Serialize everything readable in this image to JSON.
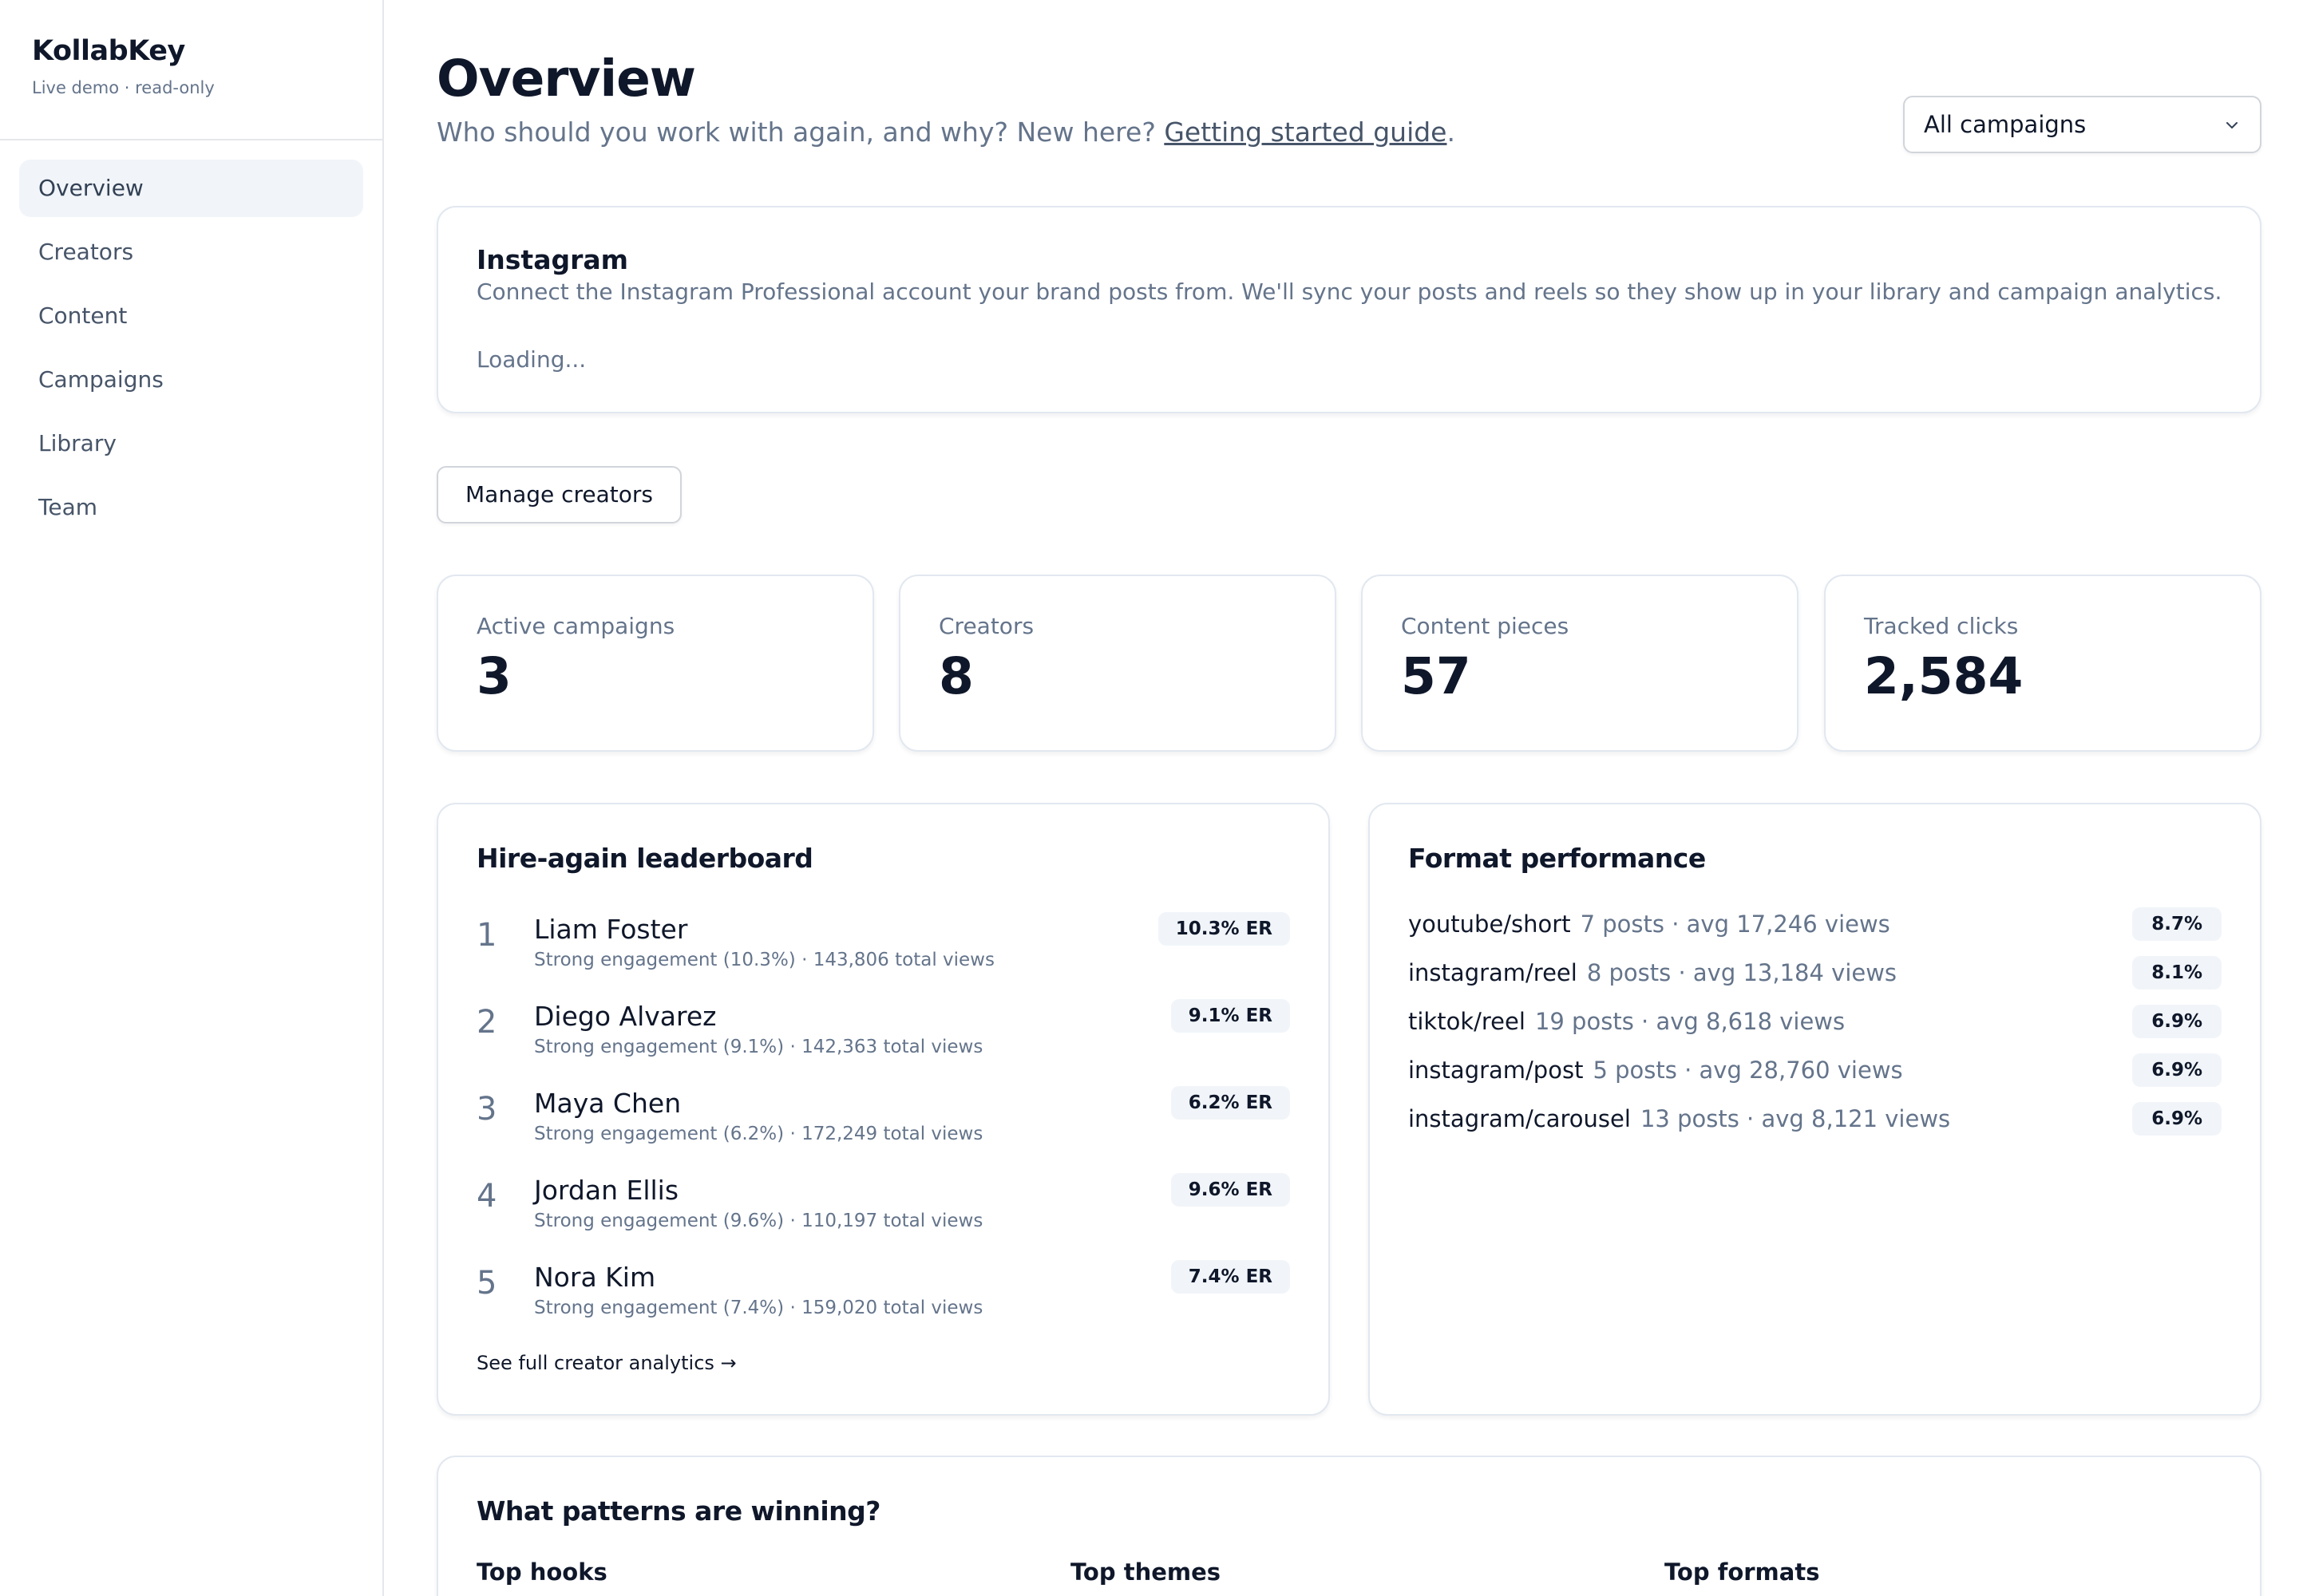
{
  "brand": {
    "name": "KollabKey",
    "subtitle": "Live demo · read-only"
  },
  "sidebar": {
    "items": [
      {
        "label": "Overview",
        "active": true
      },
      {
        "label": "Creators"
      },
      {
        "label": "Content"
      },
      {
        "label": "Campaigns"
      },
      {
        "label": "Library"
      },
      {
        "label": "Team"
      }
    ]
  },
  "header": {
    "title": "Overview",
    "subtitle_prefix": "Who should you work with again, and why? New here? ",
    "subtitle_link": "Getting started guide",
    "subtitle_suffix": ".",
    "campaign_select": "All campaigns"
  },
  "instagram": {
    "title": "Instagram",
    "description": "Connect the Instagram Professional account your brand posts from. We'll sync your posts and reels so they show up in your library and campaign analytics.",
    "status": "Loading..."
  },
  "manage_button": "Manage creators",
  "stats": [
    {
      "label": "Active campaigns",
      "value": "3"
    },
    {
      "label": "Creators",
      "value": "8"
    },
    {
      "label": "Content pieces",
      "value": "57"
    },
    {
      "label": "Tracked clicks",
      "value": "2,584"
    }
  ],
  "leaderboard": {
    "title": "Hire-again leaderboard",
    "rows": [
      {
        "rank": "1",
        "name": "Liam Foster",
        "meta": "Strong engagement (10.3%) · 143,806 total views",
        "badge": "10.3% ER"
      },
      {
        "rank": "2",
        "name": "Diego Alvarez",
        "meta": "Strong engagement (9.1%) · 142,363 total views",
        "badge": "9.1% ER"
      },
      {
        "rank": "3",
        "name": "Maya Chen",
        "meta": "Strong engagement (6.2%) · 172,249 total views",
        "badge": "6.2% ER"
      },
      {
        "rank": "4",
        "name": "Jordan Ellis",
        "meta": "Strong engagement (9.6%) · 110,197 total views",
        "badge": "9.6% ER"
      },
      {
        "rank": "5",
        "name": "Nora Kim",
        "meta": "Strong engagement (7.4%) · 159,020 total views",
        "badge": "7.4% ER"
      }
    ],
    "link": "See full creator analytics →"
  },
  "format_performance": {
    "title": "Format performance",
    "rows": [
      {
        "name": "youtube/short",
        "meta": "7 posts · avg 17,246 views",
        "badge": "8.7%"
      },
      {
        "name": "instagram/reel",
        "meta": "8 posts · avg 13,184 views",
        "badge": "8.1%"
      },
      {
        "name": "tiktok/reel",
        "meta": "19 posts · avg 8,618 views",
        "badge": "6.9%"
      },
      {
        "name": "instagram/post",
        "meta": "5 posts · avg 28,760 views",
        "badge": "6.9%"
      },
      {
        "name": "instagram/carousel",
        "meta": "13 posts · avg 8,121 views",
        "badge": "6.9%"
      }
    ]
  },
  "patterns": {
    "title": "What patterns are winning?",
    "columns": [
      "Top hooks",
      "Top themes",
      "Top formats"
    ]
  }
}
